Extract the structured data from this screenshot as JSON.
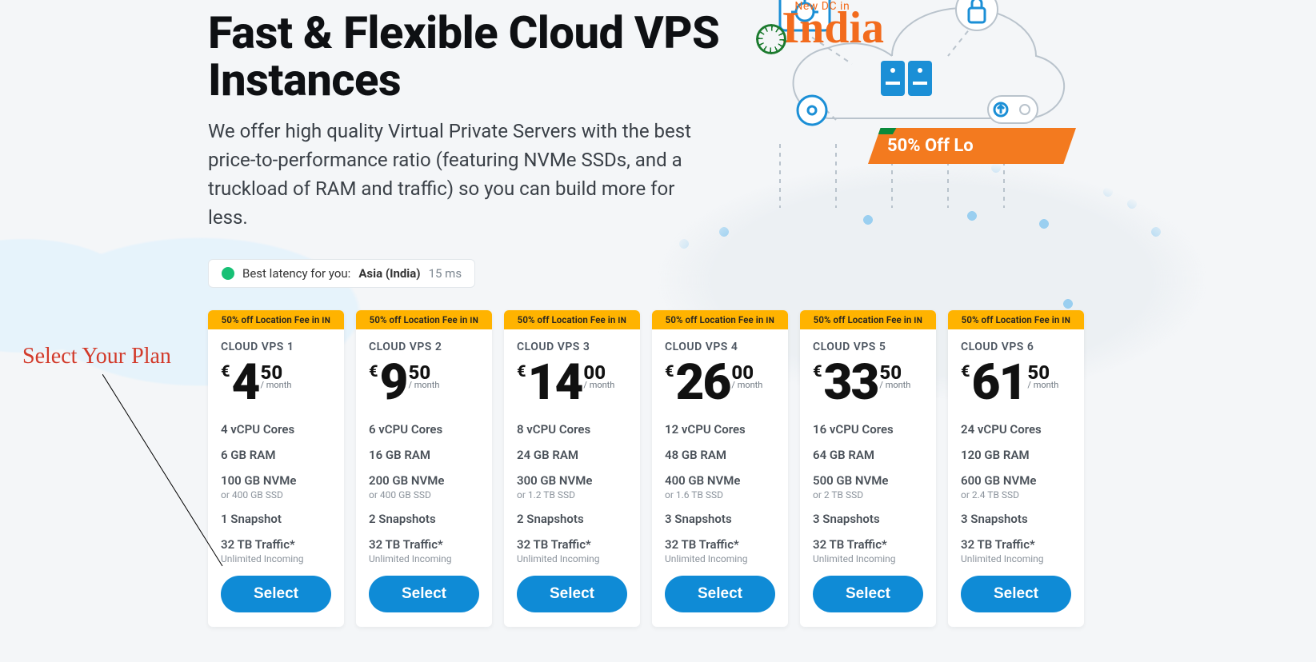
{
  "hero": {
    "title": "Fast & Flexible Cloud VPS Instances",
    "subtitle": "We offer high quality Virtual Private Servers with the best price-to-performance ratio (featuring NVMe SSDs, and a truckload of RAM and traffic) so you can build more for less."
  },
  "india_badge": {
    "small": "New DC in",
    "big": "India"
  },
  "promo_banner": "50% Off Lo",
  "latency_pill": {
    "lead": "Best latency for you:",
    "location": "Asia (India)",
    "ms": "15 ms"
  },
  "annotation": "Select Your Plan",
  "ribbon": {
    "text": "50% off Location Fee in",
    "flag": "IN"
  },
  "per_label": "/ month",
  "currency_symbol": "€",
  "select_label": "Select",
  "plans": [
    {
      "name": "CLOUD VPS 1",
      "euros": "4",
      "cents": "50",
      "cpu": "4 vCPU Cores",
      "ram": "6 GB RAM",
      "nvme": "100 GB NVMe",
      "nvme_alt": "or 400 GB SSD",
      "snap": "1 Snapshot",
      "traffic": "32 TB Traffic*",
      "traffic_sub": "Unlimited Incoming"
    },
    {
      "name": "CLOUD VPS 2",
      "euros": "9",
      "cents": "50",
      "cpu": "6 vCPU Cores",
      "ram": "16 GB RAM",
      "nvme": "200 GB NVMe",
      "nvme_alt": "or 400 GB SSD",
      "snap": "2 Snapshots",
      "traffic": "32 TB Traffic*",
      "traffic_sub": "Unlimited Incoming"
    },
    {
      "name": "CLOUD VPS 3",
      "euros": "14",
      "cents": "00",
      "cpu": "8 vCPU Cores",
      "ram": "24 GB RAM",
      "nvme": "300 GB NVMe",
      "nvme_alt": "or 1.2 TB SSD",
      "snap": "2 Snapshots",
      "traffic": "32 TB Traffic*",
      "traffic_sub": "Unlimited Incoming"
    },
    {
      "name": "CLOUD VPS 4",
      "euros": "26",
      "cents": "00",
      "cpu": "12 vCPU Cores",
      "ram": "48 GB RAM",
      "nvme": "400 GB NVMe",
      "nvme_alt": "or 1.6 TB SSD",
      "snap": "3 Snapshots",
      "traffic": "32 TB Traffic*",
      "traffic_sub": "Unlimited Incoming"
    },
    {
      "name": "CLOUD VPS 5",
      "euros": "33",
      "cents": "50",
      "cpu": "16 vCPU Cores",
      "ram": "64 GB RAM",
      "nvme": "500 GB NVMe",
      "nvme_alt": "or 2 TB SSD",
      "snap": "3 Snapshots",
      "traffic": "32 TB Traffic*",
      "traffic_sub": "Unlimited Incoming"
    },
    {
      "name": "CLOUD VPS 6",
      "euros": "61",
      "cents": "50",
      "cpu": "24 vCPU Cores",
      "ram": "120 GB RAM",
      "nvme": "600 GB NVMe",
      "nvme_alt": "or 2.4 TB SSD",
      "snap": "3 Snapshots",
      "traffic": "32 TB Traffic*",
      "traffic_sub": "Unlimited Incoming"
    }
  ]
}
